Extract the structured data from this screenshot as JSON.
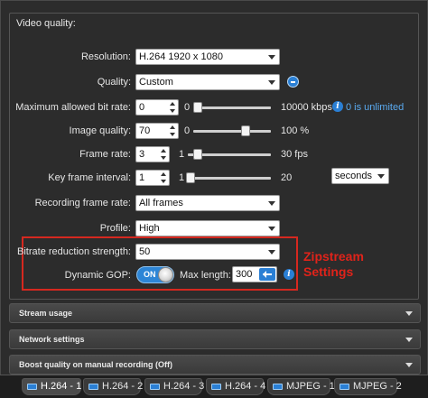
{
  "group": {
    "title": "Video quality:"
  },
  "rows": {
    "resolution": {
      "label": "Resolution:",
      "value": "H.264 1920 x 1080"
    },
    "quality": {
      "label": "Quality:",
      "value": "Custom"
    },
    "bitrate": {
      "label": "Maximum allowed bit rate:",
      "value": "0",
      "min": "0",
      "max": "10000 kbps",
      "info": "0 is unlimited",
      "slider_fraction": 0.0
    },
    "image_quality": {
      "label": "Image quality:",
      "value": "70",
      "min": "0",
      "max": "100 %",
      "slider_fraction": 0.7
    },
    "frame_rate": {
      "label": "Frame rate:",
      "value": "3",
      "min": "1",
      "max": "30 fps",
      "slider_fraction": 0.07
    },
    "key_frame": {
      "label": "Key frame interval:",
      "value": "1",
      "min": "1",
      "max": "20",
      "unit": "seconds",
      "slider_fraction": 0.0
    },
    "recording_frame_rate": {
      "label": "Recording frame rate:",
      "value": "All frames"
    },
    "profile": {
      "label": "Profile:",
      "value": "High"
    },
    "bitrate_reduction": {
      "label": "Bitrate reduction strength:",
      "value": "50"
    },
    "dynamic_gop": {
      "label": "Dynamic GOP:",
      "toggle": "ON",
      "maxlen_label": "Max length:",
      "maxlen_value": "300"
    }
  },
  "annotation": {
    "line1": "Zipstream",
    "line2": "Settings",
    "color": "#e0231a"
  },
  "sections": [
    {
      "label": "Stream usage"
    },
    {
      "label": "Network settings"
    },
    {
      "label": "Boost quality on manual recording (Off)"
    }
  ],
  "tabs": [
    {
      "label": "H.264 - 1"
    },
    {
      "label": "H.264 - 2"
    },
    {
      "label": "H.264 - 3"
    },
    {
      "label": "H.264 - 4"
    },
    {
      "label": "MJPEG - 1"
    },
    {
      "label": "MJPEG - 2"
    }
  ],
  "colors": {
    "accent": "#2a7fd4",
    "background": "#2b2b2b"
  }
}
